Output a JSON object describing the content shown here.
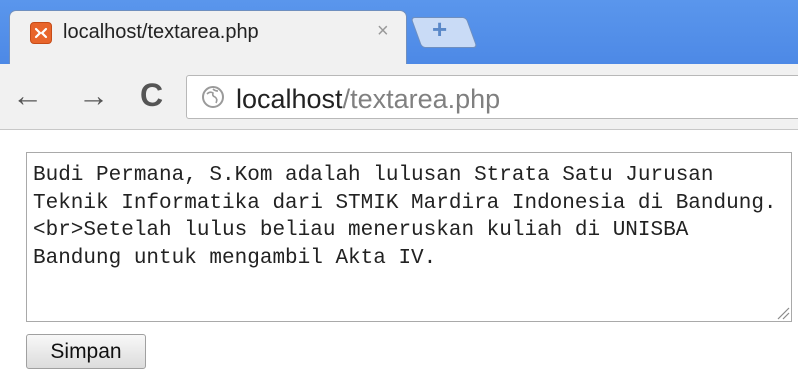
{
  "tab": {
    "title": "localhost/textarea.php",
    "close_icon": "close-icon",
    "favicon": "xampp-favicon"
  },
  "toolbar": {
    "back_icon": "back-arrow-icon",
    "forward_icon": "forward-arrow-icon",
    "reload_icon": "reload-icon",
    "url_host": "localhost",
    "url_path": "/textarea.php",
    "url_icon": "globe-icon"
  },
  "form": {
    "textarea_value": "Budi Permana, S.Kom adalah lulusan Strata Satu Jurusan Teknik Informatika dari STMIK Mardira Indonesia di Bandung. <br>Setelah lulus beliau meneruskan kuliah di UNISBA Bandung untuk mengambil Akta IV.",
    "submit_label": "Simpan"
  },
  "colors": {
    "tabstrip": "#5a96ec",
    "favicon": "#e8652b",
    "url_path": "#808080"
  }
}
